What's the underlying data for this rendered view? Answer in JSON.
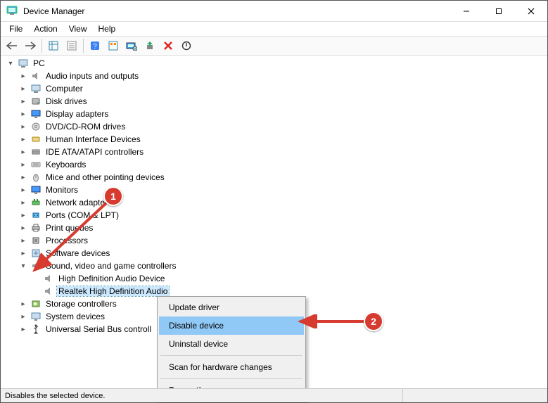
{
  "window": {
    "title": "Device Manager"
  },
  "menu": {
    "file": "File",
    "action": "Action",
    "view": "View",
    "help": "Help"
  },
  "tree": {
    "root": "PC",
    "nodes": {
      "audio_io": "Audio inputs and outputs",
      "computer": "Computer",
      "disk": "Disk drives",
      "display": "Display adapters",
      "dvd": "DVD/CD-ROM drives",
      "hid": "Human Interface Devices",
      "ide": "IDE ATA/ATAPI controllers",
      "keyboards": "Keyboards",
      "mice": "Mice and other pointing devices",
      "monitors": "Monitors",
      "netadapt": "Network adapters",
      "ports": "Ports (COM & LPT)",
      "printq": "Print queues",
      "processors": "Processors",
      "softdev": "Software devices",
      "svg": "Sound, video and game controllers",
      "svg_children": {
        "hda": "High Definition Audio Device",
        "realtek": "Realtek High Definition Audio"
      },
      "storage": "Storage controllers",
      "sysdev": "System devices",
      "usb": "Universal Serial Bus controll"
    }
  },
  "context_menu": {
    "update": "Update driver",
    "disable": "Disable device",
    "uninstall": "Uninstall device",
    "scan": "Scan for hardware changes",
    "properties": "Properties"
  },
  "status": "Disables the selected device.",
  "annotations": {
    "badge1": "1",
    "badge2": "2"
  }
}
